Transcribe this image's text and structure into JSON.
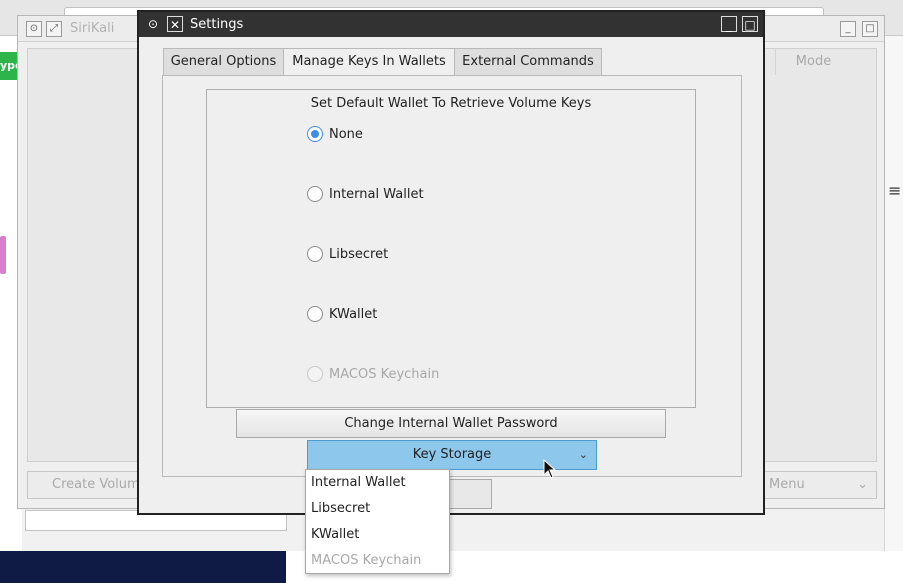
{
  "background": {
    "green_tab_text": "ype",
    "main_window": {
      "title": "SiriKali",
      "header_mode": "Mode",
      "create_button": "Create Volume",
      "menu_button": "Menu"
    }
  },
  "dialog": {
    "title": "Settings",
    "tabs": [
      {
        "label": "General Options",
        "active": false
      },
      {
        "label": "Manage Keys In Wallets",
        "active": true
      },
      {
        "label": "External Commands",
        "active": false
      }
    ],
    "group_title": "Set Default Wallet To Retrieve Volume Keys",
    "options": [
      {
        "label": "None",
        "checked": true,
        "enabled": true
      },
      {
        "label": "Internal Wallet",
        "checked": false,
        "enabled": true
      },
      {
        "label": "Libsecret",
        "checked": false,
        "enabled": true
      },
      {
        "label": "KWallet",
        "checked": false,
        "enabled": true
      },
      {
        "label": "MACOS Keychain",
        "checked": false,
        "enabled": false
      }
    ],
    "change_password_button": "Change Internal Wallet Password",
    "key_storage_button": "Key Storage",
    "key_storage_menu": [
      {
        "label": "Internal Wallet",
        "enabled": true
      },
      {
        "label": "Libsecret",
        "enabled": true
      },
      {
        "label": "KWallet",
        "enabled": true
      },
      {
        "label": "MACOS Keychain",
        "enabled": false
      }
    ]
  },
  "colors": {
    "accent": "#3d8ee8",
    "key_storage_bg": "#8dc8ec",
    "dialog_title_bg": "#323232"
  }
}
